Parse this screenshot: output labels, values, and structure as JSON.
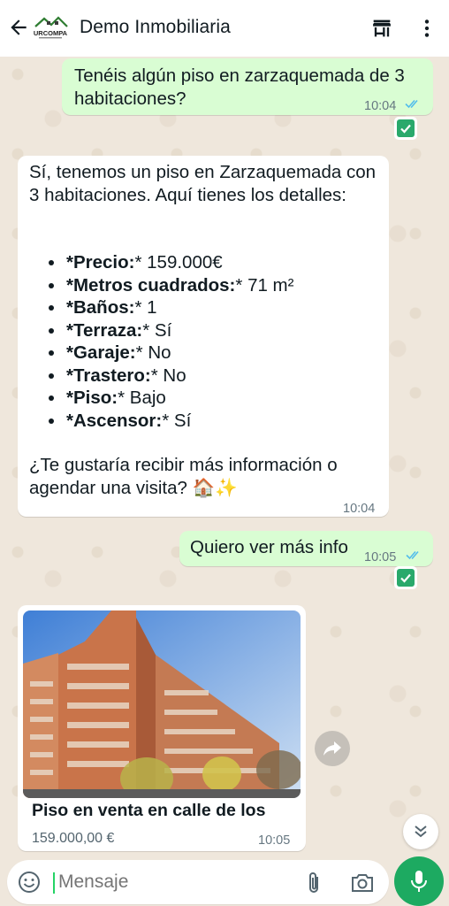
{
  "header": {
    "title": "Demo Inmobiliaria",
    "logo_text": "URCOMPA"
  },
  "messages": {
    "m1": {
      "text": "Tenéis algún piso en zarzaquemada de 3 habitaciones?",
      "time": "10:04"
    },
    "m2": {
      "intro": "Sí, tenemos un piso en Zarzaquemada con 3 habitaciones. Aquí tienes los detalles:",
      "details": [
        {
          "label": "*Precio:",
          "value": "* 159.000€"
        },
        {
          "label": "*Metros cuadrados:",
          "value": "* 71 m²"
        },
        {
          "label": "*Baños:",
          "value": "* 1"
        },
        {
          "label": "*Terraza:",
          "value": "* Sí"
        },
        {
          "label": "*Garaje:",
          "value": "* No"
        },
        {
          "label": "*Trastero:",
          "value": "* No"
        },
        {
          "label": "*Piso:",
          "value": "* Bajo"
        },
        {
          "label": "*Ascensor:",
          "value": "* Sí"
        }
      ],
      "question": "¿Te gustaría recibir más información o agendar una visita? 🏠✨",
      "time": "10:04"
    },
    "m3": {
      "text": "Quiero ver más info",
      "time": "10:05"
    },
    "m4": {
      "card_title": "Piso en venta en calle de los",
      "price": "159.000,00 €",
      "time": "10:05"
    }
  },
  "input": {
    "placeholder": "Mensaje"
  },
  "colors": {
    "outgoing": "#d9fdd3",
    "incoming": "#ffffff",
    "accent": "#1daa61",
    "read_ticks": "#53bdeb"
  }
}
